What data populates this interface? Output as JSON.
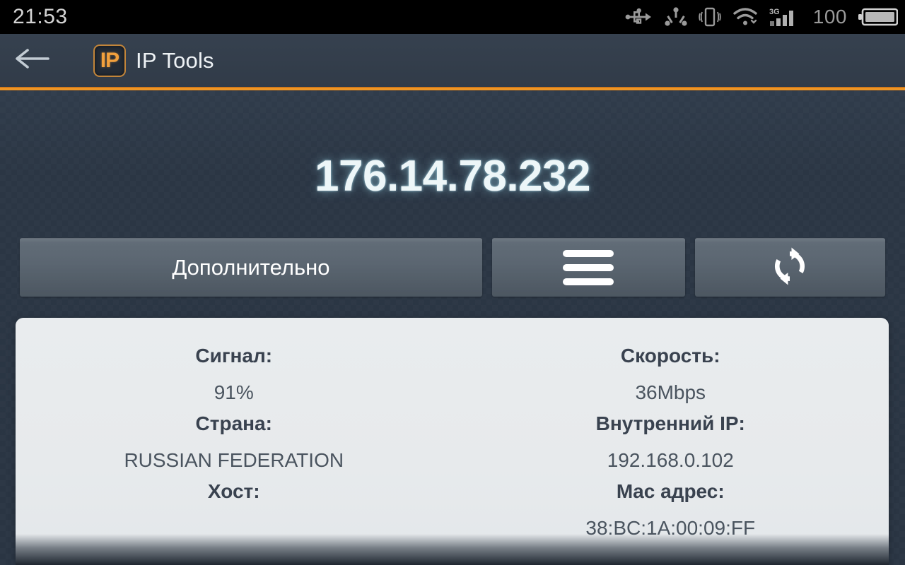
{
  "statusbar": {
    "clock": "21:53",
    "battery_percent": "100",
    "icons": [
      "usb-icon",
      "share-hub-icon",
      "vibrate-icon",
      "wifi-icon",
      "signal-3g-icon",
      "battery-icon"
    ]
  },
  "appbar": {
    "back_icon": "back-arrow-icon",
    "logo_text": "IP",
    "title": "IP Tools",
    "accent_color": "#f0911f"
  },
  "main": {
    "ip_address": "176.14.78.232",
    "buttons": {
      "more_label": "Дополнительно",
      "menu_icon": "hamburger-menu-icon",
      "refresh_icon": "refresh-icon"
    }
  },
  "info_card": {
    "fields": [
      {
        "label": "Сигнал:",
        "value": "91%"
      },
      {
        "label": "Скорость:",
        "value": "36Mbps"
      },
      {
        "label": "Страна:",
        "value": "RUSSIAN FEDERATION"
      },
      {
        "label": "Внутренний IP:",
        "value": "192.168.0.102"
      },
      {
        "label": "Хост:",
        "value": ""
      },
      {
        "label": "Mac адрес:",
        "value": "38:BC:1A:00:09:FF"
      }
    ]
  }
}
